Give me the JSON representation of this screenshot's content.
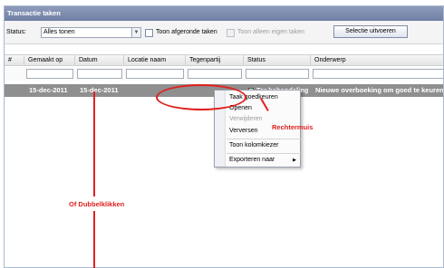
{
  "window": {
    "title": "Transactie taken"
  },
  "toolbar": {
    "status_label": "Status:",
    "status_value": "Alles tonen",
    "show_completed_label": "Toon afgeronde taken",
    "show_own_label": "Toon alleen eigen taken",
    "run_selection_label": "Selectie uitvoeren"
  },
  "grid": {
    "columns": [
      "#",
      "Gemaakt op",
      "Datum",
      "Locatie naam",
      "Tegenpartij",
      "Status",
      "Onderwerp"
    ],
    "row": {
      "made_on": "15-dec-2011",
      "date": "15-dec-2011",
      "status": "Ter behandeling",
      "subject": "Nieuwe overboeking om goed te keuren."
    }
  },
  "context_menu": {
    "items": [
      "Taak goedkeuren",
      "Openen",
      "Verwijderen",
      "Verversen",
      "Toon kolomkiezer",
      "Exporteren naar"
    ]
  },
  "annotations": {
    "right_click": "Rechtermuis",
    "double_click": "Of Dubbelklikken"
  },
  "colors": {
    "title_bar": "#7f8eb1",
    "selected_row": "#8f8f8f",
    "annotation": "#e02020"
  }
}
